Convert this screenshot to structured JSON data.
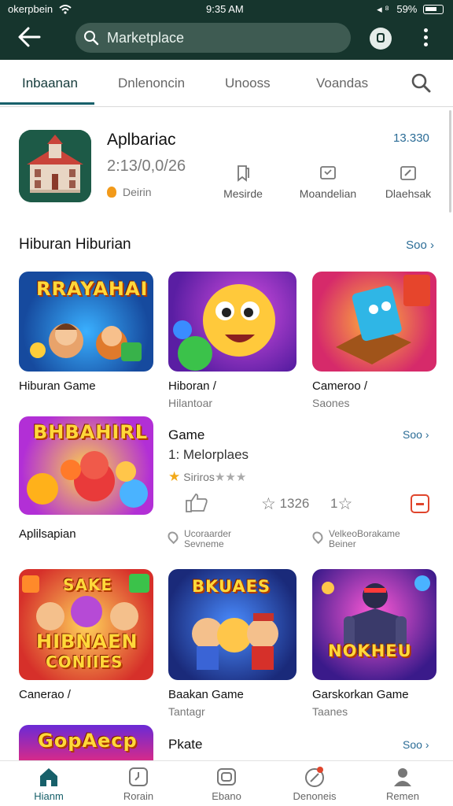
{
  "status_bar": {
    "carrier": "okerpbein",
    "time": "9:35 AM",
    "battery": "59%",
    "signal": "◂ ⁸"
  },
  "app_bar": {
    "search_placeholder": "Marketplace"
  },
  "tabs": [
    {
      "label": "Inbaanan"
    },
    {
      "label": "Dnlenoncin"
    },
    {
      "label": "Unooss"
    },
    {
      "label": "Voandas"
    }
  ],
  "featured": {
    "title": "Aplbariac",
    "date": "2:13/0,0/26",
    "price": "13.330",
    "developer": "Deirin",
    "actions": [
      {
        "label": "Mesirde",
        "icon": "bookmark-icon"
      },
      {
        "label": "Moandelian",
        "icon": "screen-icon"
      },
      {
        "label": "Dlaehsak",
        "icon": "edit-icon"
      }
    ]
  },
  "section": {
    "title": "Hiburan Hiburian",
    "see_more": "Soo"
  },
  "cards_row1": [
    {
      "banner": "RRAYAHAI",
      "title": "Hiburan Game",
      "sub": ""
    },
    {
      "banner": "",
      "title": "Hiboran /",
      "sub": "Hilantoar"
    },
    {
      "banner": "",
      "title": "Cameroo /",
      "sub": "Saones"
    }
  ],
  "card_row2": {
    "banner": "BHBAHIRL",
    "title": "Aplilsapian",
    "detail_title": "Game",
    "detail_more": "Soo",
    "detail_sub": "1: Melorplaes",
    "rating_text": "Siriros",
    "rating_value": 1,
    "rating_max": 4,
    "meta_likes": "",
    "meta_rating": "1326",
    "meta_count": "1",
    "location1_line1": "Ucoraarder",
    "location1_line2": "Sevneme",
    "location2_line1": "VelkeoBorakame",
    "location2_line2": "Beiner"
  },
  "cards_row3": [
    {
      "banner1": "SAKE",
      "banner2": "HIBNAEN",
      "banner3": "CONIIES",
      "title": "Canerao /",
      "sub": ""
    },
    {
      "banner": "BKUAES",
      "title": "Baakan Game",
      "sub": "Tantagr"
    },
    {
      "banner": "NOKHEU",
      "title": "Garskorkan Game",
      "sub": "Taanes"
    }
  ],
  "card_row4": {
    "banner": "GopAecp",
    "title": "Pkate",
    "more": "Soo"
  },
  "bottom_nav": [
    {
      "label": "Hianm",
      "icon": "home-icon"
    },
    {
      "label": "Rorain",
      "icon": "clock-icon"
    },
    {
      "label": "Ebano",
      "icon": "camera-icon"
    },
    {
      "label": "Denoneis",
      "icon": "compass-icon"
    },
    {
      "label": "Remen",
      "icon": "profile-icon"
    }
  ],
  "colors": {
    "topbar": "#16352d",
    "accent": "#17606a",
    "link": "#2b6c96"
  }
}
